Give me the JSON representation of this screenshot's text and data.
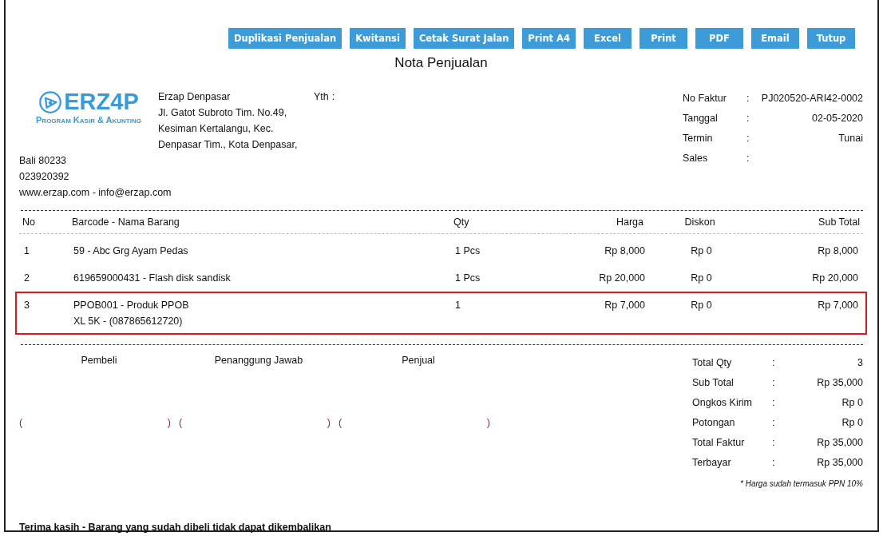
{
  "toolbar": {
    "buttons": [
      "Duplikasi Penjualan",
      "Kwitansi",
      "Cetak Surat Jalan",
      "Print A4",
      "Excel",
      "Print",
      "PDF",
      "Email",
      "Tutup"
    ]
  },
  "title": "Nota Penjualan",
  "logo": {
    "name": "ERZ4P",
    "tagline": "Program Kasir & Akunting"
  },
  "company": {
    "lines": [
      "Erzap Denpasar",
      "Jl. Gatot Subroto Tim. No.49,",
      "Kesiman Kertalangu, Kec.",
      "Denpasar Tim., Kota Denpasar,"
    ],
    "extra_lines": [
      "Bali 80233",
      "023920392",
      "www.erzap.com - info@erzap.com"
    ]
  },
  "recipient": {
    "label": "Yth",
    "separator": ":"
  },
  "invoice_info": [
    {
      "label": "No Faktur",
      "separator": ":",
      "value": "PJ020520-ARI42-0002"
    },
    {
      "label": "Tanggal",
      "separator": ":",
      "value": "02-05-2020"
    },
    {
      "label": "Termin",
      "separator": ":",
      "value": "Tunai"
    },
    {
      "label": "Sales",
      "separator": ":"
    }
  ],
  "table": {
    "columns": [
      "No",
      "Barcode - Nama Barang",
      "Qty",
      "Harga",
      "Diskon",
      "Sub Total"
    ],
    "rows": [
      {
        "no": "1",
        "item": [
          "59 - Abc Grg Ayam Pedas"
        ],
        "qty": "1 Pcs",
        "price": "Rp 8,000",
        "discount": "Rp 0",
        "subtotal": "Rp 8,000",
        "selected": false
      },
      {
        "no": "2",
        "item": [
          "619659000431 - Flash disk sandisk"
        ],
        "qty": "1 Pcs",
        "price": "Rp 20,000",
        "discount": "Rp 0",
        "subtotal": "Rp 20,000",
        "selected": false
      },
      {
        "no": "3",
        "item": [
          "PPOB001 - Produk PPOB",
          "XL 5K - (087865612720)"
        ],
        "qty": "1",
        "price": "Rp 7,000",
        "discount": "Rp 0",
        "subtotal": "Rp 7,000",
        "selected": true
      }
    ]
  },
  "signatures": [
    {
      "label": "Pembeli",
      "open": "(",
      "close": ")"
    },
    {
      "label": "Penanggung Jawab",
      "open": "(",
      "close": ")"
    },
    {
      "label": "Penjual",
      "open": "(",
      "close": ")"
    }
  ],
  "totals": [
    {
      "label": "Total Qty",
      "separator": ":",
      "value": "3"
    },
    {
      "label": "Sub Total",
      "separator": ":",
      "value": "Rp 35,000"
    },
    {
      "label": "Ongkos Kirim",
      "separator": ":",
      "value": "Rp 0"
    },
    {
      "label": "Potongan",
      "separator": ":",
      "value": "Rp 0"
    },
    {
      "label": "Total Faktur",
      "separator": ":",
      "value": "Rp 35,000"
    },
    {
      "label": "Terbayar",
      "separator": ":",
      "value": "Rp 35,000"
    }
  ],
  "tax_note": "* Harga sudah termasuk PPN 10%",
  "footer": "Terima kasih - Barang yang sudah dibeli tidak dapat dikembalikan"
}
